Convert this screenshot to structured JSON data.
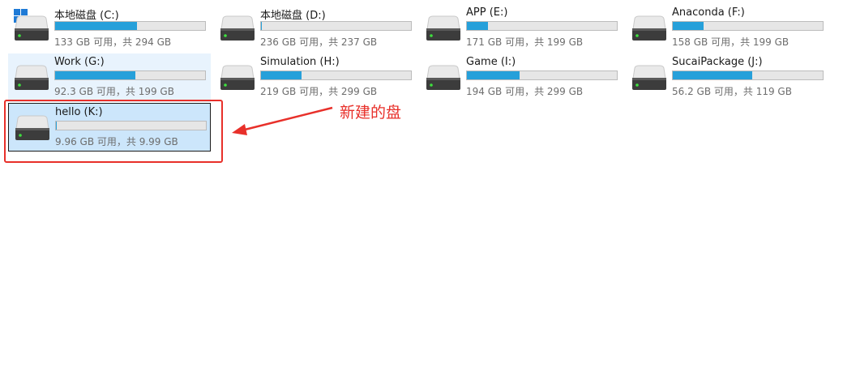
{
  "drives": [
    {
      "name": "本地磁盘 (C:)",
      "capacity": "133 GB 可用，共 294 GB",
      "used_fraction": 0.548,
      "icon": "windows-drive-icon",
      "state": "normal"
    },
    {
      "name": "本地磁盘 (D:)",
      "capacity": "236 GB 可用，共 237 GB",
      "used_fraction": 0.004,
      "icon": "hard-drive-icon",
      "state": "normal"
    },
    {
      "name": "APP (E:)",
      "capacity": "171 GB 可用，共 199 GB",
      "used_fraction": 0.141,
      "icon": "hard-drive-icon",
      "state": "normal"
    },
    {
      "name": "Anaconda (F:)",
      "capacity": "158 GB 可用，共 199 GB",
      "used_fraction": 0.206,
      "icon": "hard-drive-icon",
      "state": "normal"
    },
    {
      "name": "Work (G:)",
      "capacity": "92.3 GB 可用，共 199 GB",
      "used_fraction": 0.536,
      "icon": "hard-drive-icon",
      "state": "hover"
    },
    {
      "name": "Simulation (H:)",
      "capacity": "219 GB 可用，共 299 GB",
      "used_fraction": 0.268,
      "icon": "hard-drive-icon",
      "state": "normal"
    },
    {
      "name": "Game (I:)",
      "capacity": "194 GB 可用，共 299 GB",
      "used_fraction": 0.351,
      "icon": "hard-drive-icon",
      "state": "normal"
    },
    {
      "name": "SucaiPackage (J:)",
      "capacity": "56.2 GB 可用，共 119 GB",
      "used_fraction": 0.528,
      "icon": "hard-drive-icon",
      "state": "normal"
    },
    {
      "name": "hello (K:)",
      "capacity": "9.96 GB 可用，共 9.99 GB",
      "used_fraction": 0.003,
      "icon": "hard-drive-icon",
      "state": "selected"
    }
  ],
  "annotation": {
    "text": "新建的盘",
    "color": "#e8302a"
  },
  "colors": {
    "bar_fill": "#26a0da",
    "bar_track": "#e6e6e6",
    "selected_bg": "#cce6fb",
    "hover_bg": "#e8f3fd"
  }
}
